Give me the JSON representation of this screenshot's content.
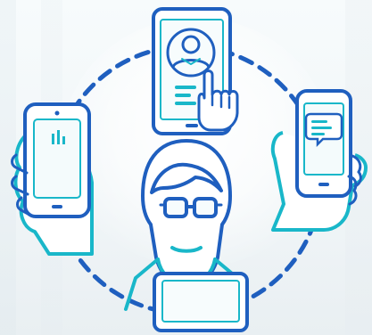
{
  "illustration": {
    "subject": "person-connecting-mobile-devices",
    "icons": [
      "tablet-profile-icon",
      "hand-tap-icon",
      "smartphone-left-icon",
      "smartphone-chat-icon",
      "person-with-glasses-icon",
      "laptop-icon",
      "dashed-circle-connector"
    ],
    "colors": {
      "stroke_blue": "#1f5fbf",
      "stroke_cyan": "#19b7c9",
      "fill_light": "#eaf7fa",
      "background": "#f3f7f9"
    }
  }
}
